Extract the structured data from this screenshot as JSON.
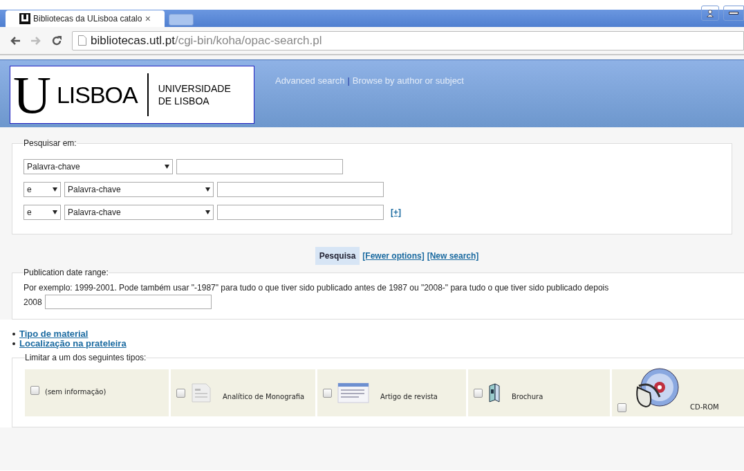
{
  "browser": {
    "tab": {
      "title": "Bibliotecas da ULisboa catalo",
      "close": "×",
      "selected": true
    },
    "address": {
      "host": "bibliotecas.utl.pt",
      "path": "/cgi-bin/koha/opac-search.pl"
    }
  },
  "header": {
    "logo": {
      "letter": "U",
      "word": "LISBOA",
      "line1": "UNIVERSIDADE",
      "line2": "DE LISBOA"
    },
    "links": [
      {
        "label": "Advanced search"
      },
      {
        "label": "Browse by author or subject"
      }
    ],
    "separator": "|"
  },
  "search_in": {
    "legend": "Pesquisar em:",
    "rows": [
      {
        "index": "Palavra-chave"
      },
      {
        "operator": "e",
        "index": "Palavra-chave"
      },
      {
        "operator": "e",
        "index": "Palavra-chave",
        "more": "[+]"
      }
    ]
  },
  "actions": {
    "submit": "Pesquisa",
    "links": [
      "[Fewer options]",
      "[New search]"
    ]
  },
  "date_range": {
    "legend": "Publication date range:",
    "hint": "Por exemplo: 1999-2001. Pode também usar \"-1987\" para tudo o que tiver sido publicado antes de 1987 ou \"2008-\" para tudo o que tiver sido publicado depois",
    "hint_end": "2008"
  },
  "options": [
    "Tipo de material",
    "Localização na prateleira"
  ],
  "types": {
    "legend": "Limitar a um dos seguintes tipos:",
    "items": [
      {
        "kind": "none",
        "label": "(sem informação)",
        "checked": false
      },
      {
        "kind": "document",
        "label": "Analítico de Monografia",
        "checked": false
      },
      {
        "kind": "article",
        "label": "Artigo de revista",
        "checked": false
      },
      {
        "kind": "brochure",
        "label": "Brochura",
        "checked": false
      },
      {
        "kind": "cdrom",
        "label": "CD-ROM",
        "checked": false
      }
    ]
  }
}
